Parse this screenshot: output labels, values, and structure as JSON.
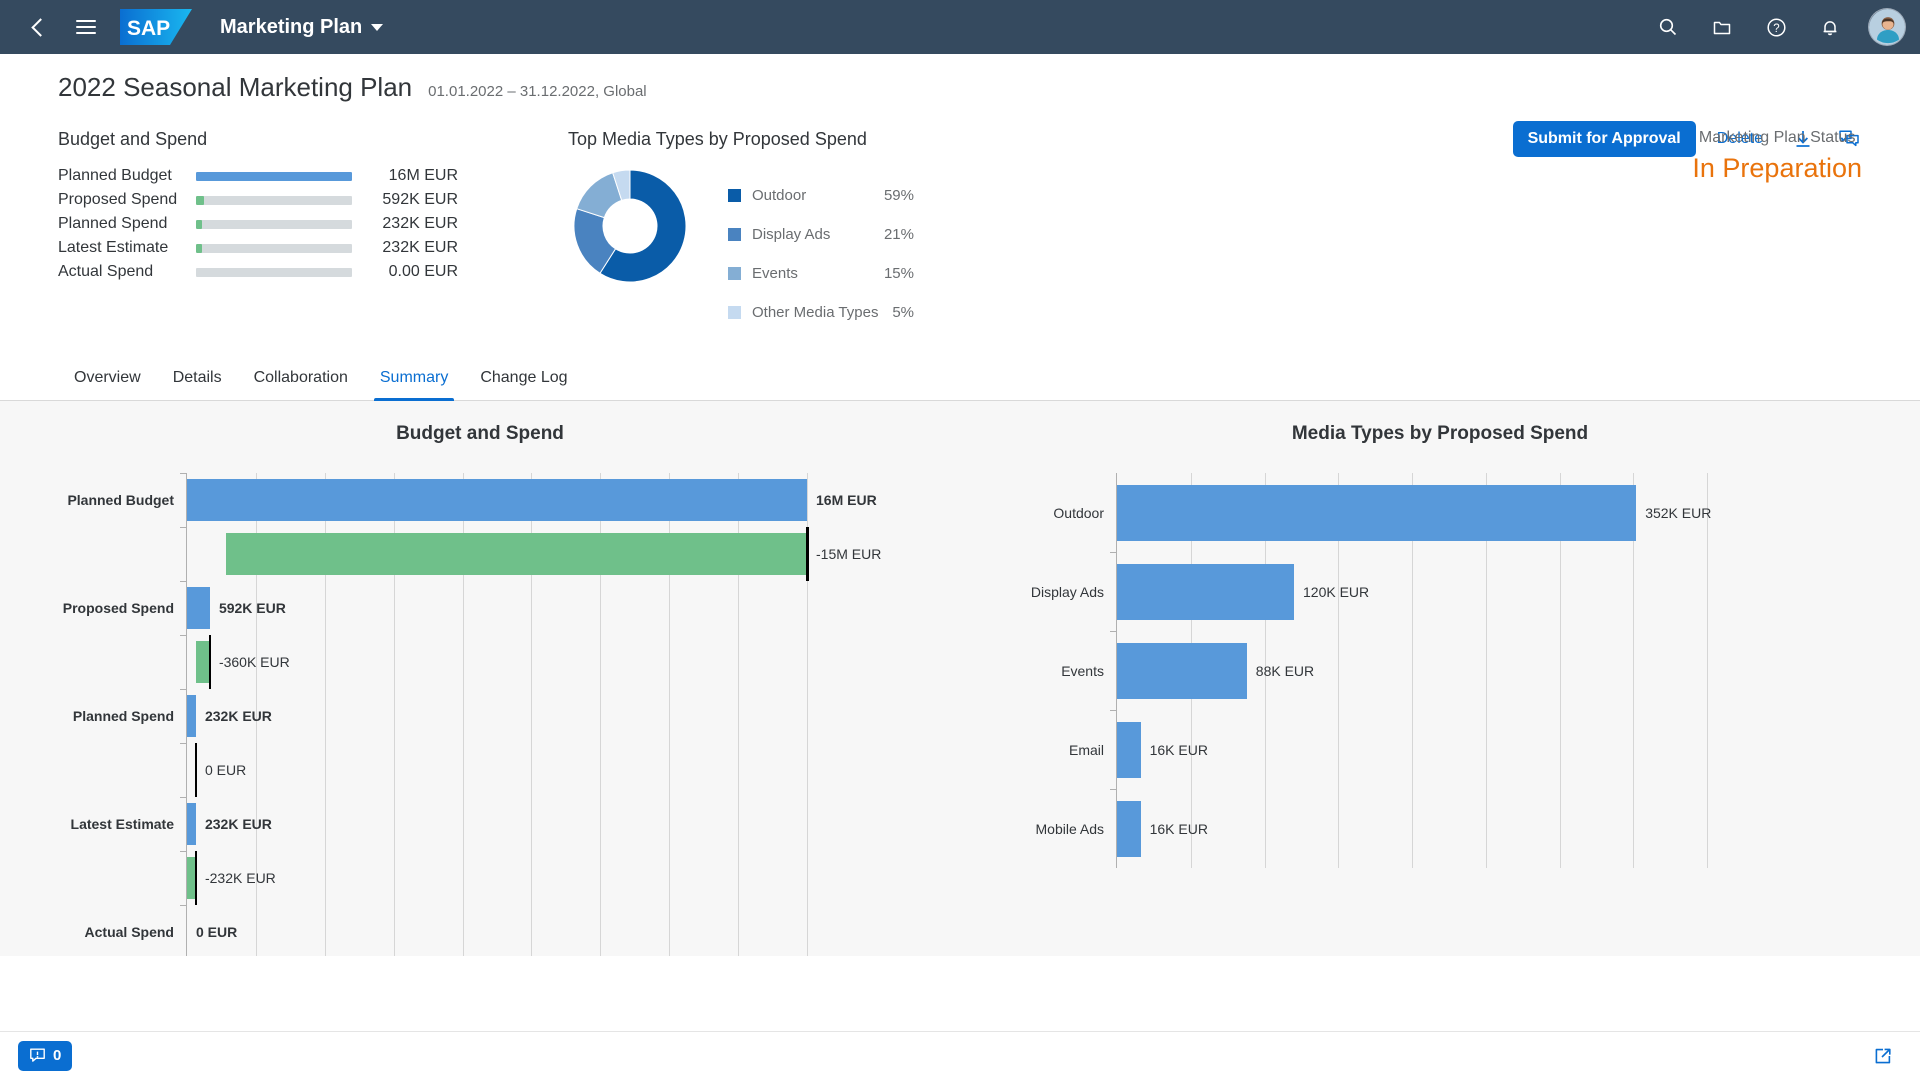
{
  "shell": {
    "app_title": "Marketing Plan",
    "back_icon": "back-chevron-icon",
    "menu_icon": "hamburger-menu-icon",
    "logo": "sap-logo",
    "icons": [
      "search-icon",
      "folder-icon",
      "help-icon",
      "bell-icon",
      "avatar"
    ]
  },
  "header": {
    "title": "2022 Seasonal Marketing Plan",
    "subtitle": "01.01.2022 – 31.12.2022, Global",
    "actions": {
      "submit": "Submit for Approval",
      "delete": "Delete",
      "download_icon": "download-icon",
      "comments_icon": "comments-icon"
    },
    "budget_block_title": "Budget and Spend",
    "kpis": [
      {
        "label": "Planned Budget",
        "value": "16M EUR",
        "fill_pct": 100,
        "color": "#5899da"
      },
      {
        "label": "Proposed Spend",
        "value": "592K EUR",
        "fill_pct": 5,
        "color": "#6fc08a"
      },
      {
        "label": "Planned Spend",
        "value": "232K EUR",
        "fill_pct": 4,
        "color": "#6fc08a"
      },
      {
        "label": "Latest Estimate",
        "value": "232K EUR",
        "fill_pct": 4,
        "color": "#6fc08a"
      },
      {
        "label": "Actual Spend",
        "value": "0.00 EUR",
        "fill_pct": 0,
        "color": "#6fc08a"
      }
    ],
    "donut_block_title": "Top Media Types by Proposed Spend",
    "status_label": "Marketing Plan Status",
    "status_value": "In Preparation",
    "status_color": "#e9730c"
  },
  "tabs": [
    {
      "label": "Overview",
      "active": false
    },
    {
      "label": "Details",
      "active": false
    },
    {
      "label": "Collaboration",
      "active": false
    },
    {
      "label": "Summary",
      "active": true
    },
    {
      "label": "Change Log",
      "active": false
    }
  ],
  "footer": {
    "message_count": "0",
    "message_icon": "message-popup-icon",
    "expand_icon": "open-in-new-window-icon"
  },
  "chart_data": [
    {
      "type": "pie",
      "id": "donut_media_types",
      "title": "Top Media Types by Proposed Spend",
      "labels": [
        "Outdoor",
        "Display Ads",
        "Events",
        "Other Media Types"
      ],
      "values": [
        59,
        21,
        15,
        5
      ],
      "display_values": [
        "59%",
        "21%",
        "15%",
        "5%"
      ],
      "colors": [
        "#0a5ca8",
        "#4a83c0",
        "#84aed4",
        "#c5daf0"
      ],
      "legend": "right",
      "donut": true
    },
    {
      "type": "bar",
      "id": "waterfall_budget_spend",
      "title": "Budget and Spend",
      "orientation": "horizontal",
      "categories": [
        "Planned Budget",
        "Proposed Spend",
        "Planned Spend",
        "Latest Estimate",
        "Actual Spend"
      ],
      "values": [
        16000000,
        592000,
        232000,
        232000,
        0
      ],
      "value_labels": [
        "16M EUR",
        "592K EUR",
        "232K EUR",
        "232K EUR",
        "0 EUR"
      ],
      "deltas": [
        -15000000,
        -360000,
        0,
        -232000
      ],
      "delta_labels": [
        "-15M EUR",
        "-360K EUR",
        "0 EUR",
        "-232K EUR"
      ],
      "value_color": "#5899da",
      "delta_color": "#6fc08a",
      "xlim": [
        0,
        16000000
      ],
      "grid": true,
      "gridlines": 9
    },
    {
      "type": "bar",
      "id": "bar_media_types",
      "title": "Media Types by Proposed Spend",
      "orientation": "horizontal",
      "categories": [
        "Outdoor",
        "Display Ads",
        "Events",
        "Email",
        "Mobile Ads"
      ],
      "values": [
        352000,
        120000,
        88000,
        16000,
        16000
      ],
      "value_labels": [
        "352K EUR",
        "120K EUR",
        "88K EUR",
        "16K EUR",
        "16K EUR"
      ],
      "bar_color": "#5899da",
      "xlim": [
        0,
        400000
      ],
      "grid": true,
      "gridlines": 8
    }
  ]
}
